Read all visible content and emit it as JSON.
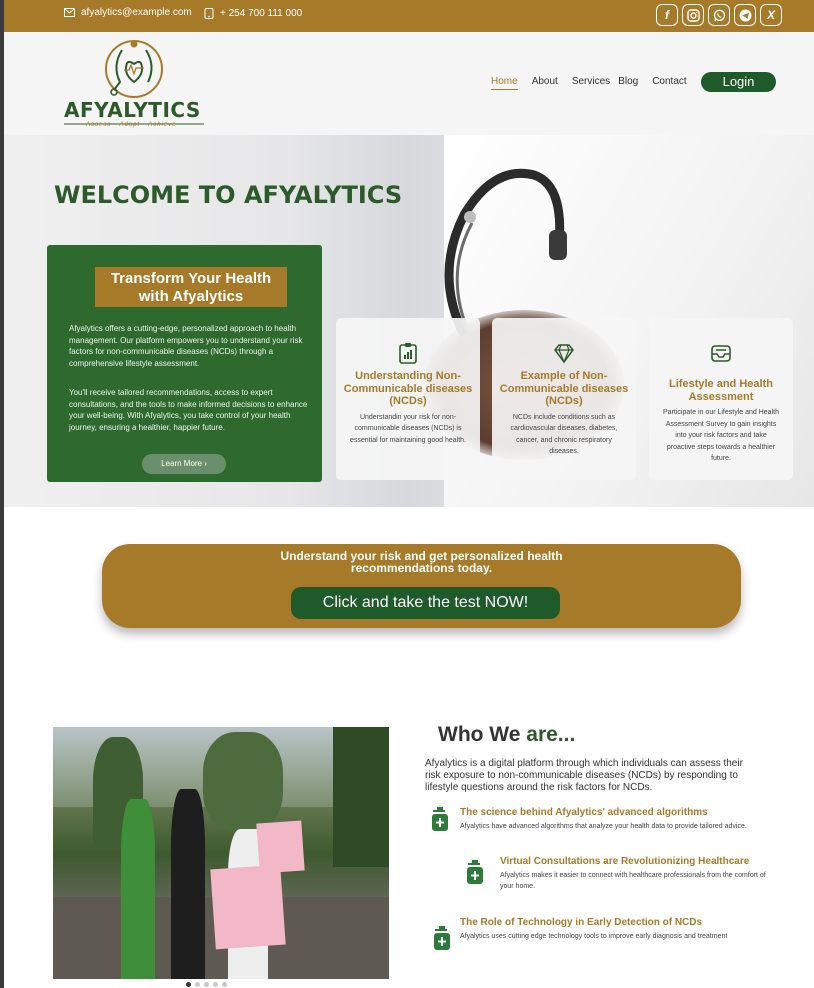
{
  "topbar": {
    "email": "afyalytics@example.com",
    "phone": "+ 254 700 111 000",
    "social_icons": [
      "facebook-icon",
      "instagram-icon",
      "whatsapp-icon",
      "telegram-icon",
      "x-icon"
    ]
  },
  "logo": {
    "brand": "AFYALYTICS",
    "tagline": "Assess · Adapt · Achieve"
  },
  "nav": {
    "items": [
      "Home",
      "About",
      "Services",
      "Blog",
      "Contact"
    ],
    "login": "Login"
  },
  "hero": {
    "title": "WELCOME TO AFYALYTICS",
    "card": {
      "heading": "Transform Your Health with Afyalytics",
      "p1": "Afyalytics offers a cutting-edge, personalized approach to health management. Our platform empowers you to understand your risk factors for non-communicable diseases (NCDs) through a comprehensive lifestyle assessment.",
      "p2": "You'll receive tailored recommendations, access to expert consultations, and the tools to make informed decisions to enhance your well-being. With Afyalytics, you take control of your health journey, ensuring a healthier, happier future.",
      "button": "Learn More ›"
    },
    "features": [
      {
        "icon": "clipboard-chart-icon",
        "title": "Understanding Non-Communicable diseases (NCDs)",
        "text": "Understandin your risk for non-communicable diseases (NCDs) is essential for maintaining good health."
      },
      {
        "icon": "diamond-icon",
        "title": "Example of Non-Communicable diseases (NCDs)",
        "text": "NCDs include conditions such as cardiovascular diseases, diabetes, cancer, and chronic respiratory diseases."
      },
      {
        "icon": "inbox-tray-icon",
        "title": "Lifestyle and Health Assessment",
        "text": "Participate in our Lifestyle and Health Assessment Survey to gain insights into your risk factors and take proactive steps towards a healthier future."
      }
    ]
  },
  "cta": {
    "heading": "Understand your risk and get personalized health recommendations today.",
    "button": "Click and take the test NOW!"
  },
  "about": {
    "title_main": "Who We ",
    "title_accent": "are...",
    "description": "Afyalytics is a digital platform through which individuals can assess their risk exposure to non-communicable diseases (NCDs) by responding to lifestyle questions around the risk factors for NCDs.",
    "points": [
      {
        "title": "The science behind Afyalytics' advanced algorithms",
        "text": "Afyalytics have advanced algorithms that analyze your health data to provide tailored advice."
      },
      {
        "title": "Virtual Consultations are Revolutionizing Healthcare",
        "text": "Afyalytics makes it easier to connect with healthcare professionals from the comfort of your home."
      },
      {
        "title": "The Role of Technology in Early Detection of NCDs",
        "text": "Afyalytics uses cutting edge technology tools to improve early diagnosis and treatment"
      }
    ]
  },
  "colors": {
    "brand_gold": "#a77a2a",
    "brand_green": "#2d5a2a",
    "button_green": "#1f5a2b"
  }
}
